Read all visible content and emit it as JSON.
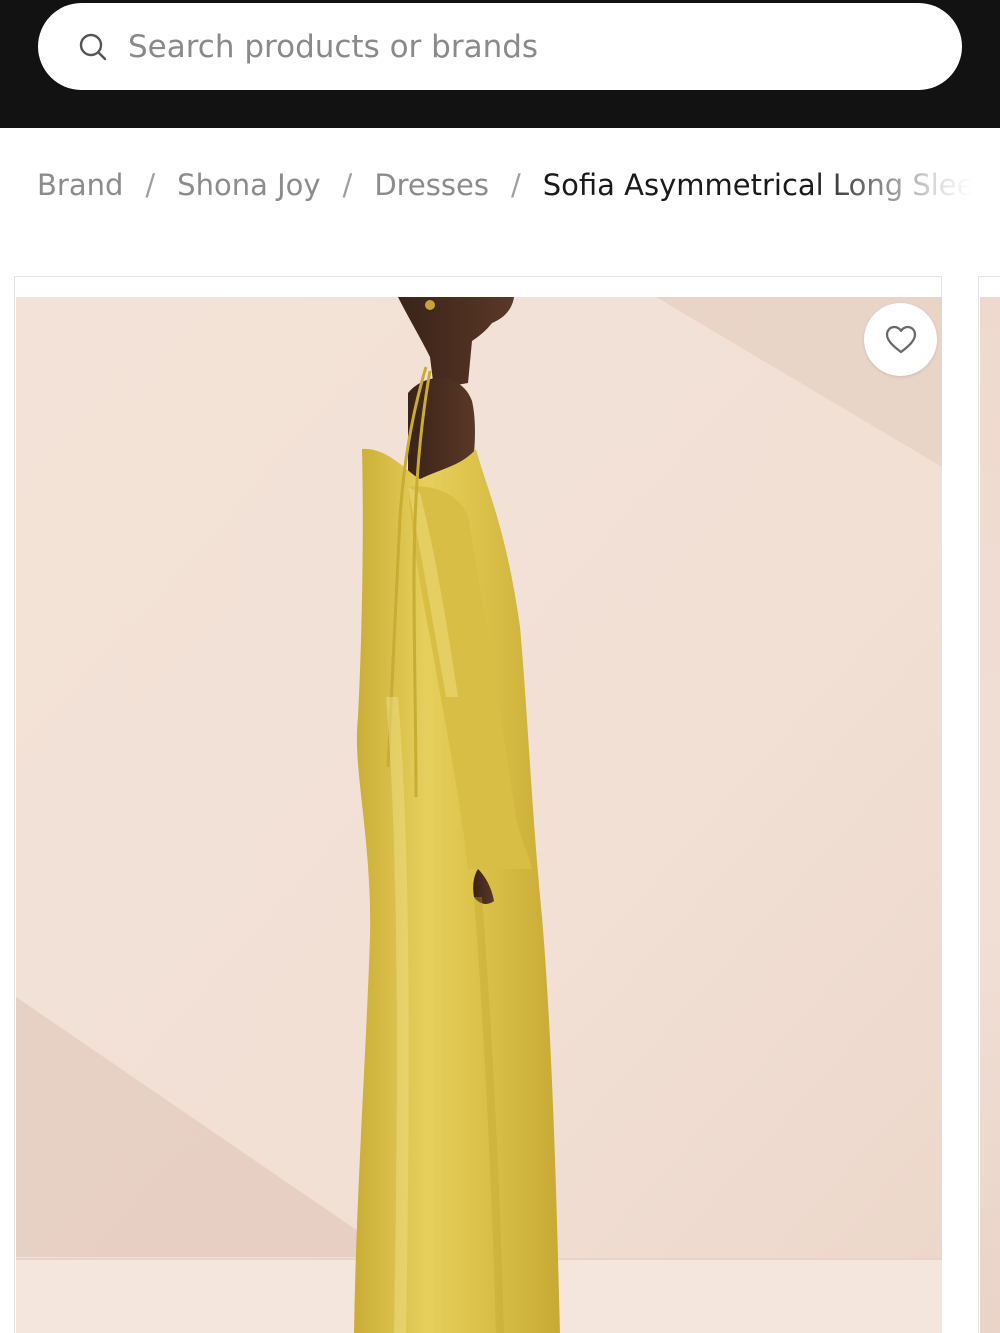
{
  "search": {
    "placeholder": "Search products or brands",
    "icon": "search-icon"
  },
  "breadcrumb": {
    "items": [
      "Brand",
      "Shona Joy",
      "Dresses"
    ],
    "separator": "/",
    "current": "Sofia Asymmetrical Long Sleeve"
  },
  "product": {
    "favorite_icon": "heart-outline-icon",
    "dress_color": "#dcc24a",
    "background_color": "#f1ded3"
  },
  "colors": {
    "header_bg": "#121212",
    "text_muted": "#8c8c8c",
    "text_strong": "#1a1a1a"
  }
}
